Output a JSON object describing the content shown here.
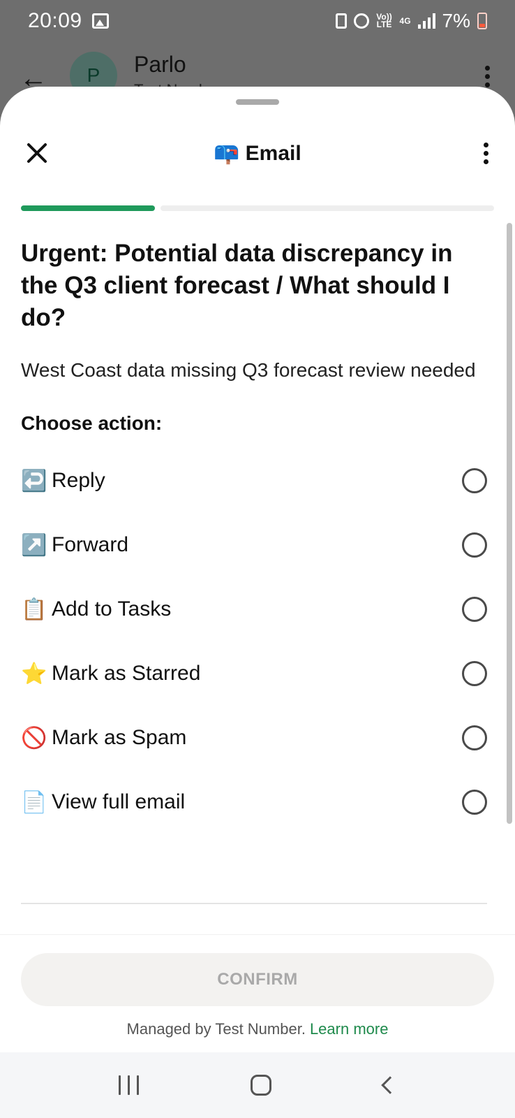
{
  "status_bar": {
    "time": "20:09",
    "network_volte": "Vo)) LTE",
    "network_4g": "4G",
    "battery": "7%",
    "icons": [
      "gallery-icon",
      "sync-icon",
      "hotspot-icon",
      "signal-icon",
      "battery-icon"
    ]
  },
  "chat": {
    "avatar_letter": "P",
    "name": "Parlo",
    "subtitle": "Test Numb..."
  },
  "sheet": {
    "title_emoji": "📪",
    "title": "Email",
    "progress": 0.28,
    "colors": {
      "accent": "#1f9a5b",
      "link": "#1f8a4c"
    }
  },
  "email": {
    "subject": "Urgent: Potential data discrepancy in the Q3 client forecast / What should I do?",
    "summary": "West Coast data missing Q3 forecast review needed"
  },
  "choose_label": "Choose action:",
  "options": [
    {
      "emoji": "↩️",
      "label": "Reply",
      "selected": false
    },
    {
      "emoji": "↗️",
      "label": "Forward",
      "selected": false
    },
    {
      "emoji": "📋",
      "label": "Add to Tasks",
      "selected": false
    },
    {
      "emoji": "⭐",
      "label": "Mark as Starred",
      "selected": false
    },
    {
      "emoji": "🚫",
      "label": "Mark as Spam",
      "selected": false
    },
    {
      "emoji": "📄",
      "label": "View full email",
      "selected": false
    }
  ],
  "footer": {
    "confirm_label": "CONFIRM",
    "managed_text": "Managed by Test Number.",
    "learn_more": "Learn more"
  }
}
